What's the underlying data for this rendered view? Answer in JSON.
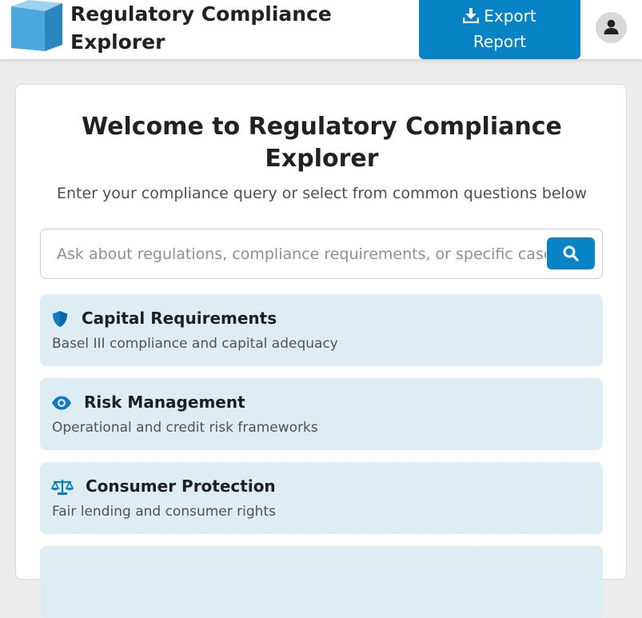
{
  "header": {
    "title": "Regulatory Compliance Explorer",
    "export_label_line1": "Export",
    "export_label_line2": "Report",
    "icons": {
      "export": "download-icon",
      "user": "user-icon",
      "logo": "cube-logo"
    }
  },
  "main": {
    "title": "Welcome to Regulatory Compliance Explorer",
    "subtitle": "Enter your compliance query or select from common questions below",
    "search": {
      "placeholder": "Ask about regulations, compliance requirements, or specific cases...",
      "icon": "search-icon"
    },
    "topics": [
      {
        "title": "Capital Requirements",
        "description": "Basel III compliance and capital adequacy",
        "icon": "shield-icon"
      },
      {
        "title": "Risk Management",
        "description": "Operational and credit risk frameworks",
        "icon": "eye-icon"
      },
      {
        "title": "Consumer Protection",
        "description": "Fair lending and consumer rights",
        "icon": "balance-scale-icon"
      }
    ]
  },
  "colors": {
    "accent": "#0883c6",
    "topic_bg": "#ddedf3",
    "page_bg": "#ececec"
  }
}
